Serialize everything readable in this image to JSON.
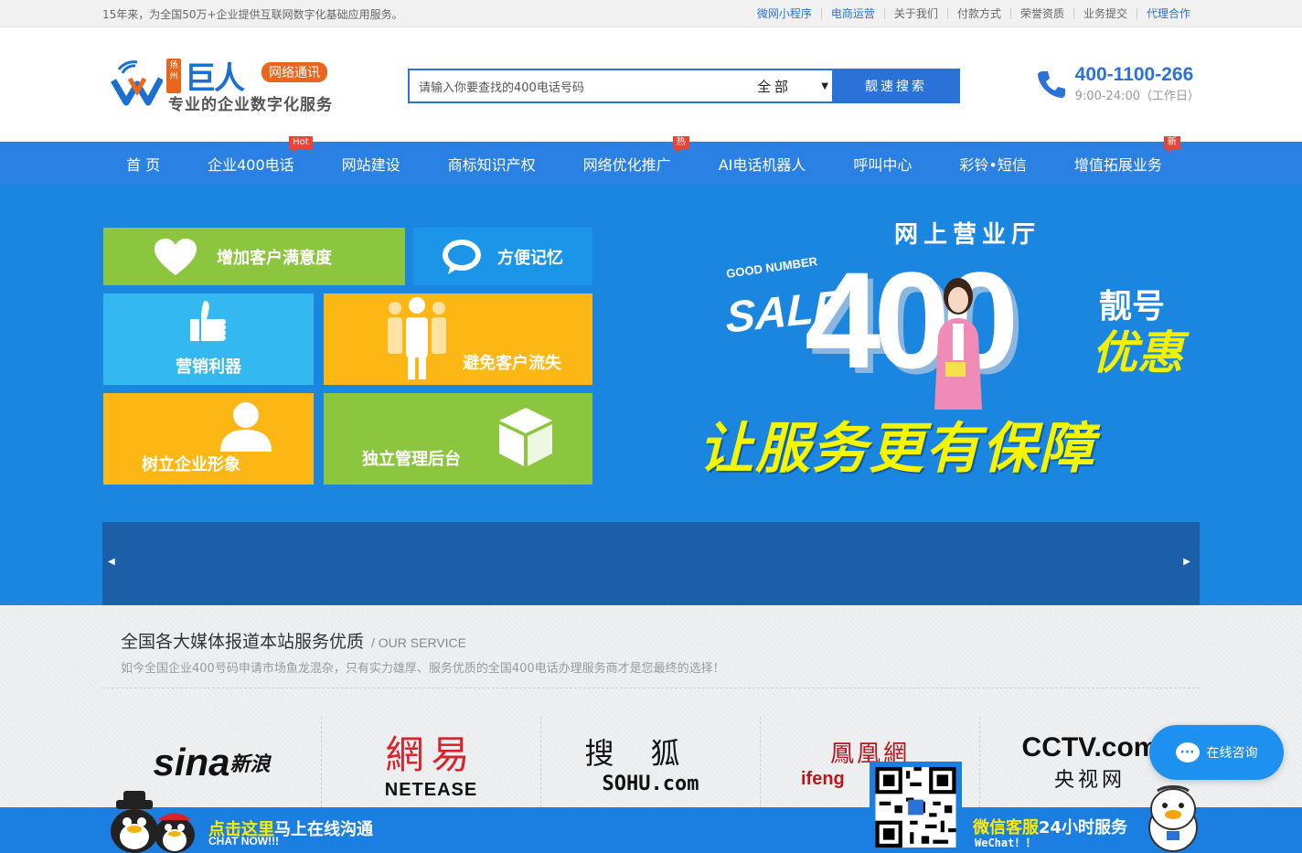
{
  "topbar": {
    "tagline": "15年来，为全国50万+企业提供互联网数字化基础应用服务。",
    "links": [
      "微网小程序",
      "电商运营",
      "关于我们",
      "付款方式",
      "荣誉资质",
      "业务提交",
      "代理合作"
    ]
  },
  "logo": {
    "city": "扬州",
    "brand": "巨人",
    "tag": "网络通讯",
    "slogan": "专业的企业数字化服务"
  },
  "search": {
    "placeholder": "请输入你要查找的400电话号码",
    "select_value": "全部",
    "button": "靓速搜索"
  },
  "hotline": {
    "number": "400-1100-266",
    "hours": "9:00-24:00（工作日）"
  },
  "nav": {
    "items": [
      {
        "label": "首 页",
        "badge": ""
      },
      {
        "label": "企业400电话",
        "badge": "Hot"
      },
      {
        "label": "网站建设",
        "badge": ""
      },
      {
        "label": "商标知识产权",
        "badge": ""
      },
      {
        "label": "网络优化推广",
        "badge": "热"
      },
      {
        "label": "AI电话机器人",
        "badge": ""
      },
      {
        "label": "呼叫中心",
        "badge": ""
      },
      {
        "label": "彩铃•短信",
        "badge": ""
      },
      {
        "label": "增值拓展业务",
        "badge": "新"
      }
    ]
  },
  "banner": {
    "tiles": [
      "增加客户满意度",
      "方便记忆",
      "营销利器",
      "避免客户流失",
      "树立企业形象",
      "独立管理后台"
    ],
    "promo": {
      "hall": "网上营业厅",
      "good": "GOOD NUMBER",
      "sale": "SALE",
      "big": "400",
      "liang": "靓号",
      "youhui": "优惠",
      "bottom": "让服务更有保障"
    }
  },
  "media": {
    "title": "全国各大媒体报道本站服务优质",
    "sub": "/ OUR SERVICE",
    "desc": "如今全国企业400号码申请市场鱼龙混杂，只有实力雄厚、服务优质的全国400电话办理服务商才是您最终的选择！",
    "logos": [
      {
        "n1": "sina",
        "n2": "新浪"
      },
      {
        "n1": "網易",
        "n2": "NETEASE"
      },
      {
        "n1": "搜狐",
        "n2": "SOHU.com"
      },
      {
        "n1": "鳳凰網",
        "n2": "ifeng"
      },
      {
        "n1": "CCTV.com",
        "n2": "央视网"
      }
    ]
  },
  "float": {
    "consult": "在线咨询",
    "chat_hl": "点击这里",
    "chat_rest": "马上在线沟通",
    "chat_en": "CHAT NOW!!!",
    "wx_hl": "微信客服",
    "wx_rest": "24小时服务",
    "wx_en": "WeChat！！"
  },
  "colors": {
    "brand_blue": "#2b72d8",
    "nav_blue": "#2b80e4",
    "banner_blue": "#1b86e0",
    "accent_orange": "#e8671c",
    "promo_yellow": "#f5f500"
  }
}
